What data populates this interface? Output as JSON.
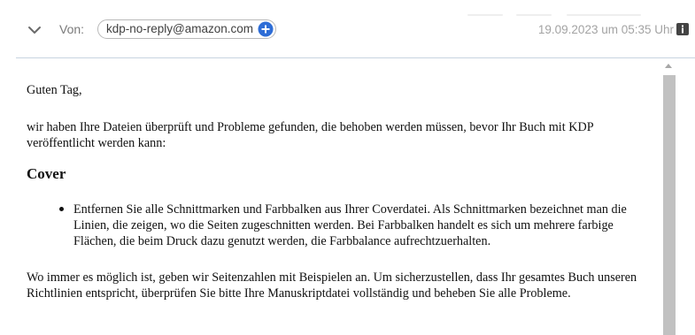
{
  "header": {
    "from_label": "Von:",
    "sender_address": "kdp-no-reply@amazon.com",
    "date": "19.09.2023 um 05:35 Uhr"
  },
  "icons": {
    "collapse": "chevron-down-icon",
    "add_contact": "plus-circle-icon",
    "info": "info-icon"
  },
  "colors": {
    "accent": "#2e6dd6",
    "divider": "#c8d4e0",
    "scrollbar_thumb": "#c1c1c1"
  },
  "message": {
    "greeting": "Guten Tag,",
    "intro": "wir haben Ihre Dateien überprüft und Probleme gefunden, die behoben werden müssen, bevor Ihr Buch mit KDP veröffentlicht werden kann:",
    "section_heading": "Cover",
    "bullets": [
      "Entfernen Sie alle Schnittmarken und Farbbalken aus Ihrer Coverdatei. Als Schnittmarken bezeichnet man die Linien, die zeigen, wo die Seiten zugeschnitten werden. Bei Farbbalken handelt es sich um mehrere farbige Flächen, die beim Druck dazu genutzt werden, die Farbbalance aufrechtzuerhalten."
    ],
    "closing": "Wo immer es möglich ist, geben wir Seitenzahlen mit Beispielen an. Um sicherzustellen, dass Ihr gesamtes Buch unseren Richtlinien entspricht, überprüfen Sie bitte Ihre Manuskriptdatei vollständig und beheben Sie alle Probleme."
  }
}
